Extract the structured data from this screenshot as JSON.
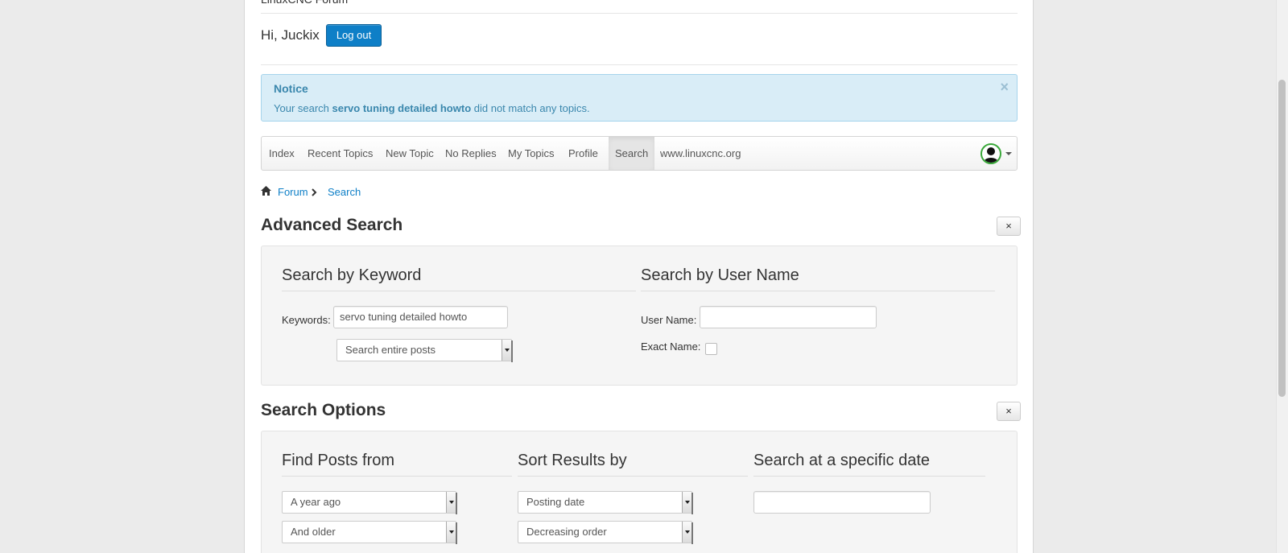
{
  "site": {
    "title": "LinuxCNC Forum"
  },
  "user": {
    "greeting": "Hi, Juckix",
    "logout_label": "Log out"
  },
  "notice": {
    "title": "Notice",
    "text_before": "Your search ",
    "query": "servo tuning detailed howto",
    "text_after": " did not match any topics.",
    "close": "×"
  },
  "nav": {
    "items": [
      "Index",
      "Recent Topics",
      "New Topic",
      "No Replies",
      "My Topics",
      "Profile",
      "Search",
      "www.linuxcnc.org"
    ],
    "active": "Search"
  },
  "breadcrumb": [
    "Forum",
    "Search"
  ],
  "advanced_search": {
    "title": "Advanced Search",
    "collapse": "×",
    "keyword": {
      "heading": "Search by Keyword",
      "label": "Keywords:",
      "value": "servo tuning detailed howto",
      "scope": "Search entire posts"
    },
    "username": {
      "heading": "Search by User Name",
      "label": "User Name:",
      "value": "",
      "exact_label": "Exact Name:"
    }
  },
  "search_options": {
    "title": "Search Options",
    "collapse": "×",
    "find_posts": {
      "heading": "Find Posts from",
      "period": "A year ago",
      "direction": "And older"
    },
    "sort": {
      "heading": "Sort Results by",
      "field": "Posting date",
      "order": "Decreasing order"
    },
    "date": {
      "heading": "Search at a specific date",
      "value": ""
    }
  },
  "colors": {
    "accent": "#0e7fc7",
    "notice_bg": "#d9edf7",
    "notice_text": "#3a87ad"
  }
}
